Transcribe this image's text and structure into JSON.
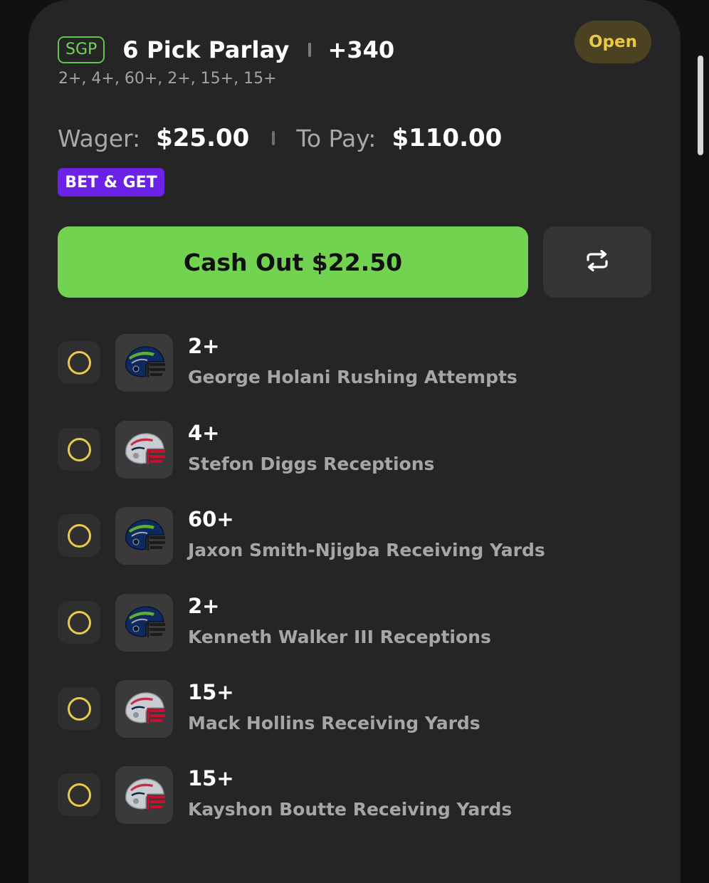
{
  "header": {
    "badge": "SGP",
    "title": "6 Pick Parlay",
    "odds": "+340",
    "status": "Open",
    "legs_summary": "2+, 4+, 60+, 2+, 15+, 15+"
  },
  "money": {
    "wager_label": "Wager:",
    "wager_value": "$25.00",
    "topay_label": "To Pay:",
    "topay_value": "$110.00"
  },
  "promo_badge": "BET & GET",
  "cashout_label": "Cash Out $22.50",
  "icons": {
    "swap": "swap-arrows-icon",
    "leg_status": "open-circle-icon",
    "team_logo": "football-helmet-icon"
  },
  "colors": {
    "accent_green": "#72d351",
    "pending_yellow": "#e9c94a",
    "promo_purple": "#6b22e6",
    "seahawks_navy": "#0f2a5e",
    "patriots_silver": "#c9ccd1",
    "patriots_red": "#c8102e"
  },
  "legs": [
    {
      "line": "2+",
      "market": "George Holani Rushing Attempts",
      "team": "seahawks"
    },
    {
      "line": "4+",
      "market": "Stefon Diggs Receptions",
      "team": "patriots"
    },
    {
      "line": "60+",
      "market": "Jaxon Smith-Njigba Receiving Yards",
      "team": "seahawks"
    },
    {
      "line": "2+",
      "market": "Kenneth Walker III Receptions",
      "team": "seahawks"
    },
    {
      "line": "15+",
      "market": "Mack Hollins Receiving Yards",
      "team": "patriots"
    },
    {
      "line": "15+",
      "market": "Kayshon Boutte Receiving Yards",
      "team": "patriots"
    }
  ]
}
